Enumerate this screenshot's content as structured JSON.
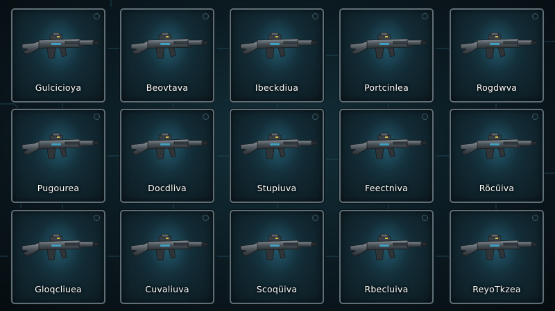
{
  "weapons": [
    {
      "name": "Gulcicioya"
    },
    {
      "name": "Beovtava"
    },
    {
      "name": "Ibeckdiua"
    },
    {
      "name": "Portcinlea"
    },
    {
      "name": "Rogdwva"
    },
    {
      "name": "Pugourea"
    },
    {
      "name": "Docdliva"
    },
    {
      "name": "Stupiuva"
    },
    {
      "name": "Feectniva"
    },
    {
      "name": "Röcüiva"
    },
    {
      "name": "Gloqcliuea"
    },
    {
      "name": "Cuvaliuva"
    },
    {
      "name": "Scoqüiva"
    },
    {
      "name": "Rbecluiva"
    },
    {
      "name": "ReyoTkzea"
    }
  ],
  "colors": {
    "accent": "#3fa4c8",
    "card_border": "#5f6f78",
    "label": "#ffffff"
  }
}
